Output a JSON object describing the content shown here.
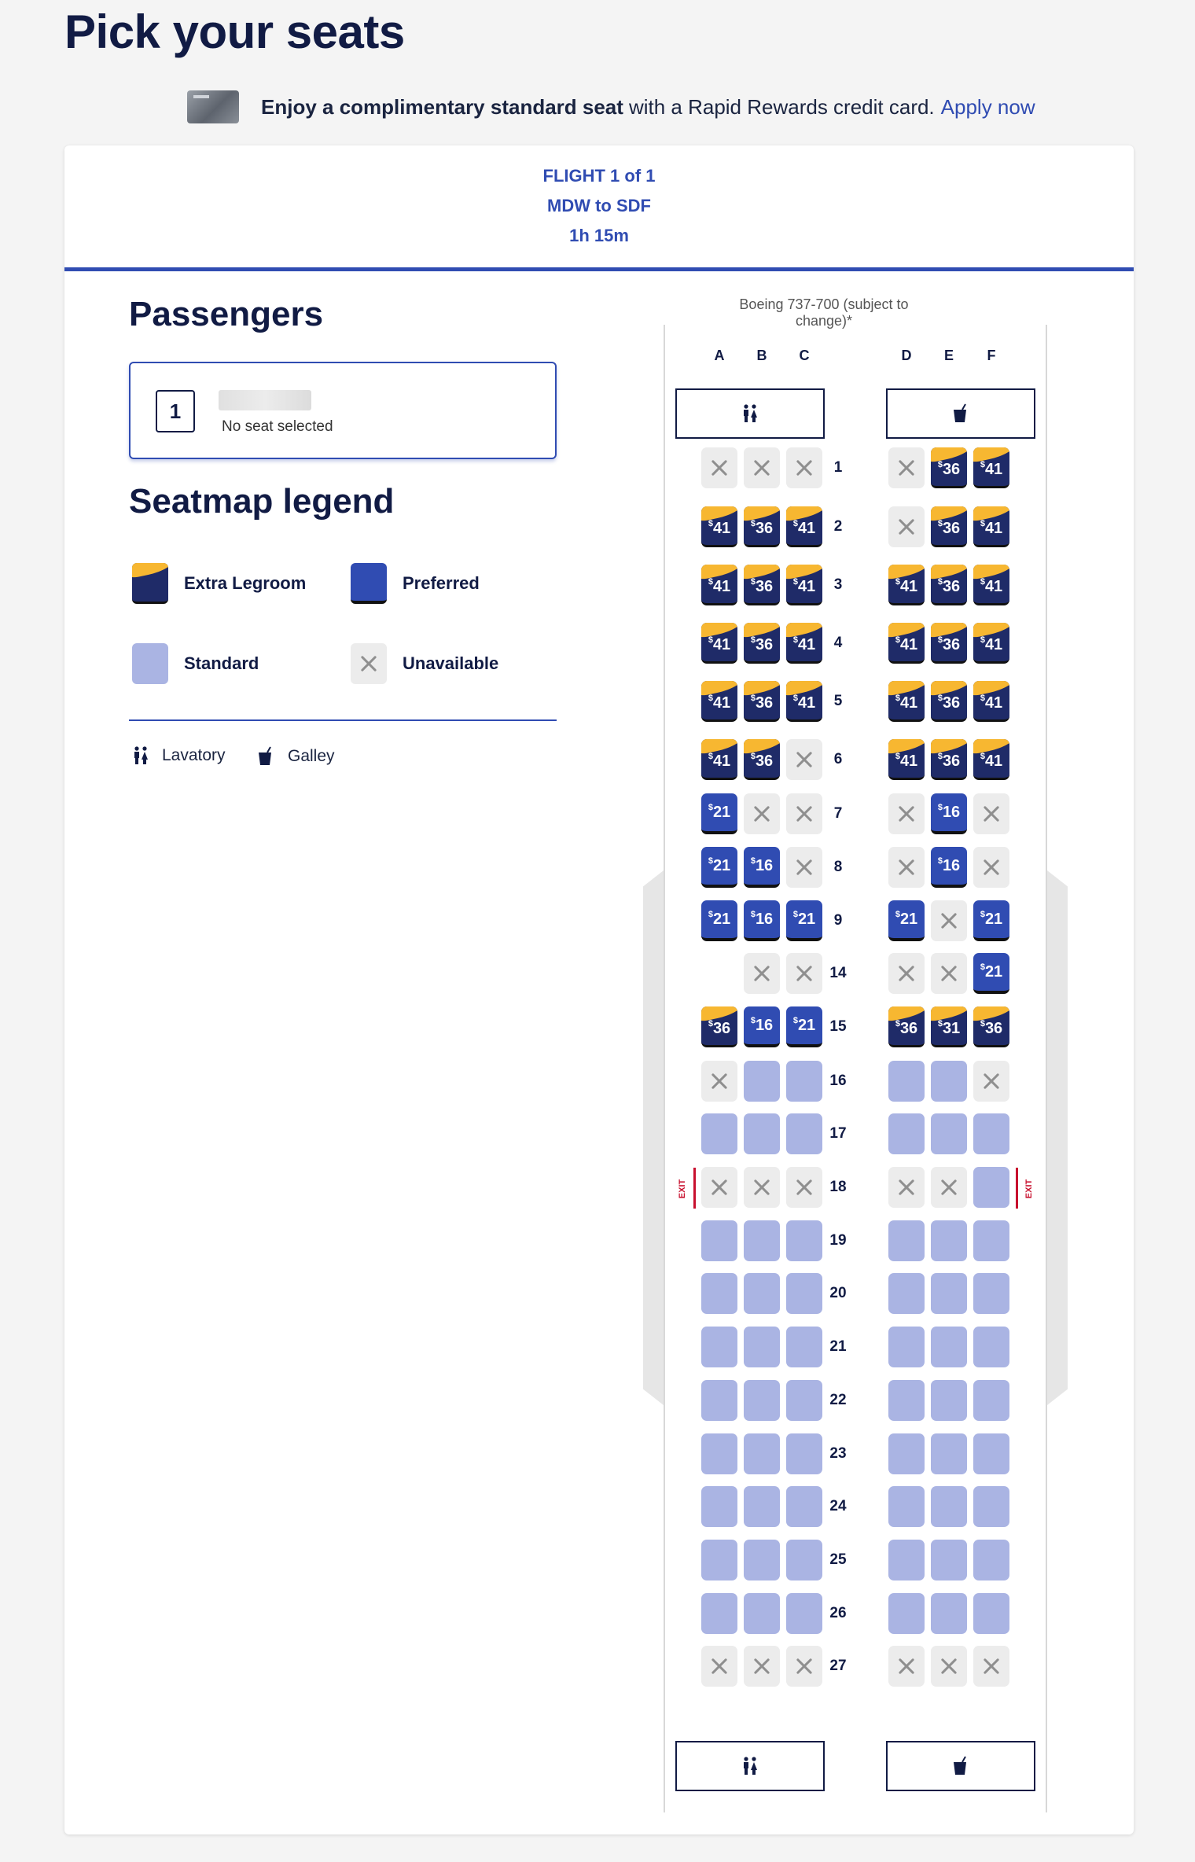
{
  "page": {
    "title": "Pick your seats"
  },
  "promo": {
    "bold": "Enjoy a complimentary standard seat",
    "text": "with a Rapid Rewards credit card.",
    "link": "Apply now"
  },
  "flight": {
    "line1": "FLIGHT 1 of 1",
    "line2": "MDW to SDF",
    "line3": "1h 15m"
  },
  "passengers": {
    "title": "Passengers",
    "items": [
      {
        "number": "1",
        "status": "No seat selected"
      }
    ]
  },
  "legend": {
    "title": "Seatmap legend",
    "items": [
      {
        "type": "xl",
        "label": "Extra Legroom"
      },
      {
        "type": "pref",
        "label": "Preferred"
      },
      {
        "type": "std",
        "label": "Standard"
      },
      {
        "type": "na",
        "label": "Unavailable"
      }
    ],
    "amenities": [
      {
        "icon": "lavatory-icon",
        "label": "Lavatory"
      },
      {
        "icon": "galley-icon",
        "label": "Galley"
      }
    ]
  },
  "aircraft": {
    "note": "Boeing 737-700 (subject to change)*",
    "columns": [
      "A",
      "B",
      "C",
      "D",
      "E",
      "F"
    ],
    "exit_label": "EXIT"
  },
  "colors": {
    "brand_blue": "#304cb2",
    "navy": "#111b44",
    "gold": "#f7b731",
    "standard": "#aab4e3",
    "exit_red": "#c8102e"
  },
  "rows": [
    {
      "row": "1",
      "seats": [
        {
          "t": "na"
        },
        {
          "t": "na"
        },
        {
          "t": "na"
        },
        {
          "t": "na"
        },
        {
          "t": "xl",
          "p": "36"
        },
        {
          "t": "xl",
          "p": "41"
        }
      ]
    },
    {
      "row": "2",
      "seats": [
        {
          "t": "xl",
          "p": "41"
        },
        {
          "t": "xl",
          "p": "36"
        },
        {
          "t": "xl",
          "p": "41"
        },
        {
          "t": "na"
        },
        {
          "t": "xl",
          "p": "36"
        },
        {
          "t": "xl",
          "p": "41"
        }
      ]
    },
    {
      "row": "3",
      "seats": [
        {
          "t": "xl",
          "p": "41"
        },
        {
          "t": "xl",
          "p": "36"
        },
        {
          "t": "xl",
          "p": "41"
        },
        {
          "t": "xl",
          "p": "41"
        },
        {
          "t": "xl",
          "p": "36"
        },
        {
          "t": "xl",
          "p": "41"
        }
      ]
    },
    {
      "row": "4",
      "seats": [
        {
          "t": "xl",
          "p": "41"
        },
        {
          "t": "xl",
          "p": "36"
        },
        {
          "t": "xl",
          "p": "41"
        },
        {
          "t": "xl",
          "p": "41"
        },
        {
          "t": "xl",
          "p": "36"
        },
        {
          "t": "xl",
          "p": "41"
        }
      ]
    },
    {
      "row": "5",
      "seats": [
        {
          "t": "xl",
          "p": "41"
        },
        {
          "t": "xl",
          "p": "36"
        },
        {
          "t": "xl",
          "p": "41"
        },
        {
          "t": "xl",
          "p": "41"
        },
        {
          "t": "xl",
          "p": "36"
        },
        {
          "t": "xl",
          "p": "41"
        }
      ]
    },
    {
      "row": "6",
      "seats": [
        {
          "t": "xl",
          "p": "41"
        },
        {
          "t": "xl",
          "p": "36"
        },
        {
          "t": "na"
        },
        {
          "t": "xl",
          "p": "41"
        },
        {
          "t": "xl",
          "p": "36"
        },
        {
          "t": "xl",
          "p": "41"
        }
      ]
    },
    {
      "row": "7",
      "seats": [
        {
          "t": "pref",
          "p": "21"
        },
        {
          "t": "na"
        },
        {
          "t": "na"
        },
        {
          "t": "na"
        },
        {
          "t": "pref",
          "p": "16"
        },
        {
          "t": "na"
        }
      ]
    },
    {
      "row": "8",
      "seats": [
        {
          "t": "pref",
          "p": "21"
        },
        {
          "t": "pref",
          "p": "16"
        },
        {
          "t": "na"
        },
        {
          "t": "na"
        },
        {
          "t": "pref",
          "p": "16"
        },
        {
          "t": "na"
        }
      ]
    },
    {
      "row": "9",
      "seats": [
        {
          "t": "pref",
          "p": "21"
        },
        {
          "t": "pref",
          "p": "16"
        },
        {
          "t": "pref",
          "p": "21"
        },
        {
          "t": "pref",
          "p": "21"
        },
        {
          "t": "na"
        },
        {
          "t": "pref",
          "p": "21"
        }
      ]
    },
    {
      "row": "14",
      "seats": [
        {
          "t": "none"
        },
        {
          "t": "na"
        },
        {
          "t": "na"
        },
        {
          "t": "na"
        },
        {
          "t": "na"
        },
        {
          "t": "pref",
          "p": "21"
        }
      ]
    },
    {
      "row": "15",
      "exit": true,
      "seats": [
        {
          "t": "xl",
          "p": "36"
        },
        {
          "t": "pref",
          "p": "16"
        },
        {
          "t": "pref",
          "p": "21"
        },
        {
          "t": "xl",
          "p": "36"
        },
        {
          "t": "xl",
          "p": "31"
        },
        {
          "t": "xl",
          "p": "36"
        }
      ]
    },
    {
      "row": "16",
      "seats": [
        {
          "t": "na"
        },
        {
          "t": "std"
        },
        {
          "t": "std"
        },
        {
          "t": "std"
        },
        {
          "t": "std"
        },
        {
          "t": "na"
        }
      ]
    },
    {
      "row": "17",
      "seats": [
        {
          "t": "std"
        },
        {
          "t": "std"
        },
        {
          "t": "std"
        },
        {
          "t": "std"
        },
        {
          "t": "std"
        },
        {
          "t": "std"
        }
      ]
    },
    {
      "row": "18",
      "seats": [
        {
          "t": "na"
        },
        {
          "t": "na"
        },
        {
          "t": "na"
        },
        {
          "t": "na"
        },
        {
          "t": "na"
        },
        {
          "t": "std"
        }
      ]
    },
    {
      "row": "19",
      "seats": [
        {
          "t": "std"
        },
        {
          "t": "std"
        },
        {
          "t": "std"
        },
        {
          "t": "std"
        },
        {
          "t": "std"
        },
        {
          "t": "std"
        }
      ]
    },
    {
      "row": "20",
      "seats": [
        {
          "t": "std"
        },
        {
          "t": "std"
        },
        {
          "t": "std"
        },
        {
          "t": "std"
        },
        {
          "t": "std"
        },
        {
          "t": "std"
        }
      ]
    },
    {
      "row": "21",
      "seats": [
        {
          "t": "std"
        },
        {
          "t": "std"
        },
        {
          "t": "std"
        },
        {
          "t": "std"
        },
        {
          "t": "std"
        },
        {
          "t": "std"
        }
      ]
    },
    {
      "row": "22",
      "seats": [
        {
          "t": "std"
        },
        {
          "t": "std"
        },
        {
          "t": "std"
        },
        {
          "t": "std"
        },
        {
          "t": "std"
        },
        {
          "t": "std"
        }
      ]
    },
    {
      "row": "23",
      "seats": [
        {
          "t": "std"
        },
        {
          "t": "std"
        },
        {
          "t": "std"
        },
        {
          "t": "std"
        },
        {
          "t": "std"
        },
        {
          "t": "std"
        }
      ]
    },
    {
      "row": "24",
      "seats": [
        {
          "t": "std"
        },
        {
          "t": "std"
        },
        {
          "t": "std"
        },
        {
          "t": "std"
        },
        {
          "t": "std"
        },
        {
          "t": "std"
        }
      ]
    },
    {
      "row": "25",
      "seats": [
        {
          "t": "std"
        },
        {
          "t": "std"
        },
        {
          "t": "std"
        },
        {
          "t": "std"
        },
        {
          "t": "std"
        },
        {
          "t": "std"
        }
      ]
    },
    {
      "row": "26",
      "seats": [
        {
          "t": "std"
        },
        {
          "t": "std"
        },
        {
          "t": "std"
        },
        {
          "t": "std"
        },
        {
          "t": "std"
        },
        {
          "t": "std"
        }
      ]
    },
    {
      "row": "27",
      "seats": [
        {
          "t": "na"
        },
        {
          "t": "na"
        },
        {
          "t": "na"
        },
        {
          "t": "na"
        },
        {
          "t": "na"
        },
        {
          "t": "na"
        }
      ]
    }
  ]
}
